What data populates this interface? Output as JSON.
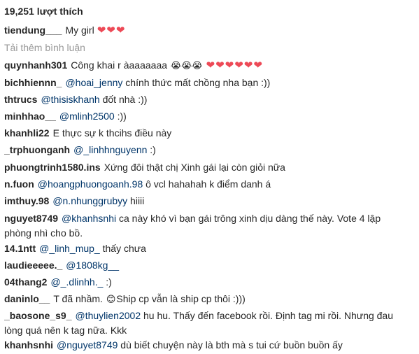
{
  "likes": "19,251 lượt thích",
  "caption": {
    "user": "tiendung___",
    "text": "My girl",
    "hearts": "❤❤❤"
  },
  "load_more": "Tải thêm bình luận",
  "comments": [
    {
      "user": "quynhanh301",
      "mention": "",
      "text": "Công khai r àaaaaaaa",
      "emoji": "😭😭😭",
      "hearts": "❤❤❤❤❤❤"
    },
    {
      "user": "bichhiennn_",
      "mention": "@hoai_jenny",
      "text": "chính thức mất chồng nha bạn :))"
    },
    {
      "user": "thtrucs",
      "mention": "@thisiskhanh",
      "text": "đốt nhà :))"
    },
    {
      "user": "minhhao__",
      "mention": "@mlinh2500",
      "text": ":))"
    },
    {
      "user": "khanhli22",
      "mention": "",
      "text": "E thực sự k thcihs điều này"
    },
    {
      "user": "_trphuonganh",
      "mention": "@_linhhnguyenn",
      "text": ":)"
    },
    {
      "user": "phuongtrinh1580.ins",
      "mention": "",
      "text": "Xứng đôi thật chị Xinh gái lại còn giỏi nữa"
    },
    {
      "user": "n.fuon",
      "mention": "@hoangphuongoanh.98",
      "text": "ô vcl hahahah k điểm danh á"
    },
    {
      "user": "imthuy.98",
      "mention": "@n.nhunggrubyy",
      "text": "hiiii"
    },
    {
      "user": "nguyet8749",
      "mention": "@khanhsnhi",
      "text": "ca này khó vì bạn gái trông xinh dịu dàng thế này. Vote 4 lập",
      "text2": "phòng nhì cho bồ."
    },
    {
      "user": "14.1ntt",
      "mention": "@_linh_mup_",
      "text": "thấy chưa"
    },
    {
      "user": "laudieeeee._",
      "mention": "@1808kg__",
      "text": ""
    },
    {
      "user": "04thang2",
      "mention": "@_.dlinhh._",
      "text": ":)"
    },
    {
      "user": "daninlo__",
      "mention": "",
      "text": "T đã nhầm.",
      "emoji": "😊",
      "text_after": "Ship cp vẫn là ship cp thôi :)))"
    },
    {
      "user": "_baosone_s9_",
      "mention": "@thuylien2002",
      "text": "hu hu. Thấy đến facebook rồi. Định tag mi rồi. Nhưng đau",
      "text2": "lòng quá nên k tag nữa. Kkk"
    },
    {
      "user": "khanhsnhi",
      "mention": "@nguyet8749",
      "text": "dù biết chuyện này là bth mà s tui cứ buồn buồn ấy"
    }
  ]
}
